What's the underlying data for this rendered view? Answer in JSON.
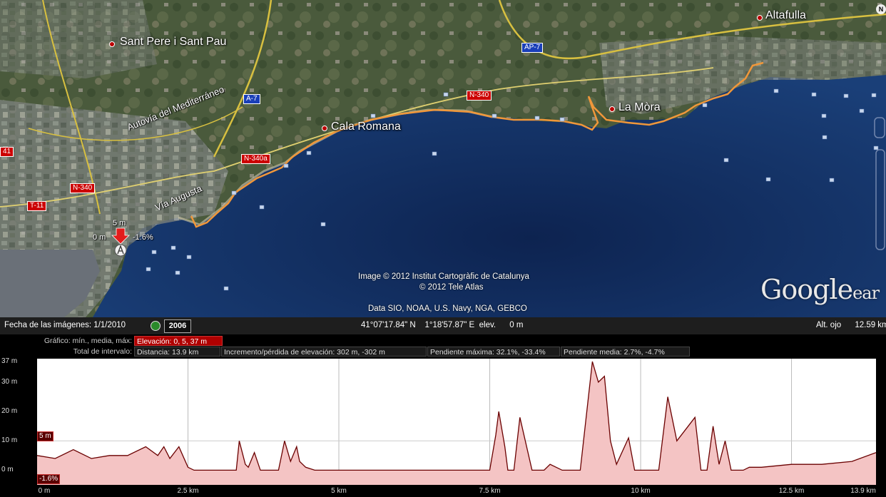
{
  "map": {
    "places": [
      {
        "name": "Sant Pere i Sant Pau"
      },
      {
        "name": "Cala Romana"
      },
      {
        "name": "La Mòra"
      },
      {
        "name": "Altafulla"
      }
    ],
    "roads": {
      "ap7": "AP-7",
      "a7": "A-7",
      "n340": "N-340",
      "n340a": "N-340a",
      "n340_left": "N-340",
      "t11": "T-11",
      "n41": "41"
    },
    "road_names": {
      "autovia": "Autovía del Mediterráneo",
      "via_augusta": "Vía Augusta"
    },
    "marker": {
      "elevation": "5 m",
      "distance": "0 m",
      "slope": "-1.6%"
    },
    "credits": {
      "line1": "Image © 2012 Institut Cartogràfic de Catalunya",
      "line2": "© 2012 Tele Atlas",
      "line3": "Data SIO, NOAA, U.S. Navy, NGA, GEBCO"
    },
    "logo": "Google",
    "logo_suffix": "ear",
    "compass": "N",
    "route_color": "#f0973a"
  },
  "status_bar": {
    "imagery_date": "Fecha de las imágenes: 1/1/2010",
    "year": "2006",
    "coords": "41°07'17.84\" N    1°18'57.87\" E  elev.      0 m",
    "eye_alt": "Alt. ojo      12.59 km"
  },
  "profile": {
    "graph_label": "Gráfico: mín., media, máx:",
    "elevation_stat": "Elevación: 0, 5, 37 m",
    "interval_label": "Total de intervalo:",
    "distance": "Distancia: 13.9 km",
    "gain_loss": "Incremento/pérdida de elevación: 302 m, -302 m",
    "max_slope": "Pendiente máxima: 32.1%, -33.4%",
    "avg_slope": "Pendiente media: 2.7%, -4.7%",
    "y_ticks": [
      "37 m",
      "30 m",
      "20 m",
      "10 m",
      "0 m"
    ],
    "x_ticks": [
      "0 m",
      "2.5 km",
      "5 km",
      "7.5 km",
      "10 km",
      "12.5 km",
      "13.9 km"
    ],
    "readout_elev": "5 m",
    "readout_slope": "-1.6%",
    "fill_color": "#f4c4c4",
    "line_color": "#6a0000"
  },
  "chart_data": {
    "type": "area",
    "title": "",
    "xlabel": "",
    "ylabel": "",
    "x_unit": "km",
    "y_unit": "m",
    "xlim": [
      0,
      13.9
    ],
    "ylim": [
      -5,
      38
    ],
    "x": [
      0,
      0.3,
      0.6,
      0.9,
      1.2,
      1.5,
      1.8,
      2.0,
      2.1,
      2.2,
      2.35,
      2.5,
      2.6,
      2.7,
      2.8,
      3.0,
      3.3,
      3.35,
      3.45,
      3.5,
      3.6,
      3.7,
      4.0,
      4.1,
      4.2,
      4.3,
      4.35,
      4.45,
      4.6,
      5.0,
      6.0,
      7.0,
      7.5,
      7.6,
      7.65,
      7.75,
      7.8,
      7.9,
      8.0,
      8.2,
      8.3,
      8.4,
      8.5,
      8.7,
      9.0,
      9.2,
      9.3,
      9.4,
      9.5,
      9.6,
      9.8,
      9.9,
      10.0,
      10.2,
      10.3,
      10.45,
      10.6,
      10.9,
      11.0,
      11.1,
      11.2,
      11.3,
      11.4,
      11.5,
      11.6,
      11.7,
      11.8,
      12.0,
      12.5,
      13.0,
      13.5,
      13.9
    ],
    "y": [
      5,
      4,
      7,
      4,
      5,
      5,
      8,
      5,
      8,
      4,
      8,
      1,
      0,
      0,
      0,
      0,
      0,
      10,
      2,
      1,
      6,
      0,
      0,
      10,
      3,
      8,
      3,
      1,
      0,
      0,
      0,
      0,
      0,
      12,
      20,
      8,
      0,
      0,
      18,
      0,
      0,
      0,
      2,
      0,
      0,
      37,
      30,
      32,
      10,
      2,
      11,
      0,
      0,
      0,
      0,
      25,
      10,
      18,
      0,
      0,
      15,
      2,
      10,
      0,
      0,
      0,
      1,
      1,
      2,
      2,
      3,
      6
    ]
  }
}
